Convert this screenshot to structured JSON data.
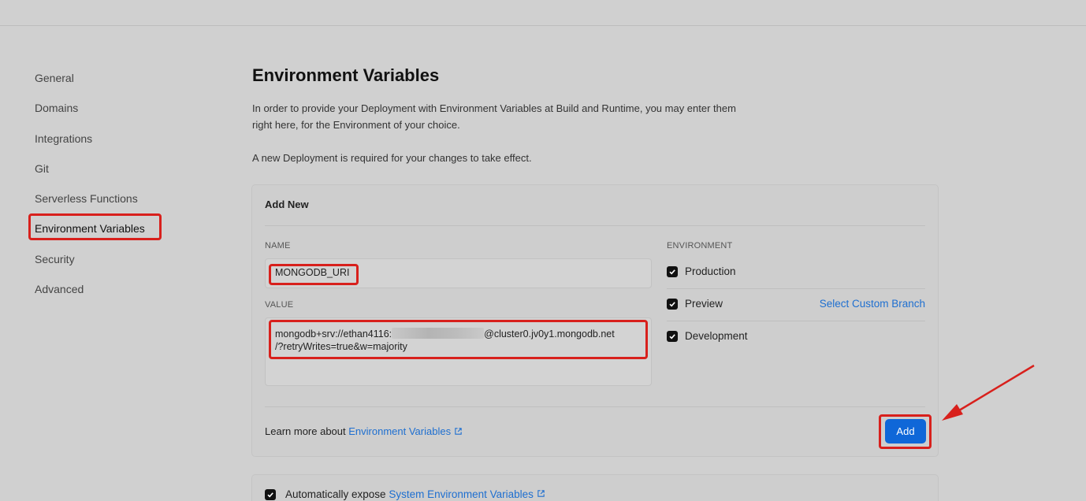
{
  "sidebar": {
    "items": [
      {
        "label": "General"
      },
      {
        "label": "Domains"
      },
      {
        "label": "Integrations"
      },
      {
        "label": "Git"
      },
      {
        "label": "Serverless Functions"
      },
      {
        "label": "Environment Variables"
      },
      {
        "label": "Security"
      },
      {
        "label": "Advanced"
      }
    ]
  },
  "main": {
    "title": "Environment Variables",
    "description": "In order to provide your Deployment with Environment Variables at Build and Runtime, you may enter them right here, for the Environment of your choice.",
    "note": "A new Deployment is required for your changes to take effect."
  },
  "add_new": {
    "title": "Add New",
    "name_label": "NAME",
    "name_value": "MONGODB_URI",
    "value_label": "VALUE",
    "value_prefix": "mongodb+srv://ethan4116:",
    "value_suffix": "@cluster0.jv0y1.mongodb.net",
    "value_line2": "/?retryWrites=true&w=majority",
    "environment_label": "ENVIRONMENT",
    "environments": [
      {
        "label": "Production",
        "checked": true
      },
      {
        "label": "Preview",
        "checked": true
      },
      {
        "label": "Development",
        "checked": true
      }
    ],
    "custom_branch_link": "Select Custom Branch",
    "learn_more_prefix": "Learn more about",
    "learn_more_link": "Environment Variables",
    "add_button": "Add"
  },
  "system_vars": {
    "prefix": "Automatically expose",
    "link": "System Environment Variables",
    "checked": true
  },
  "colors": {
    "highlight": "#d8201c",
    "link": "#1e6fd0",
    "button": "#0f67d8"
  },
  "icons": [
    "checkbox-checked-icon",
    "external-link-icon",
    "red-arrow-annotation"
  ]
}
